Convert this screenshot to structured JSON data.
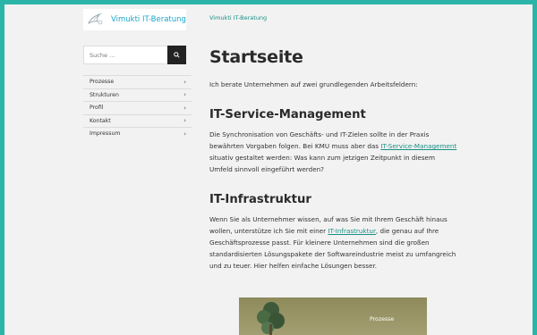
{
  "brand": {
    "logo_text": "Vimukti IT-Beratung",
    "accent_color": "#1aa6c9",
    "frame_color": "#2bb5a8"
  },
  "header": {
    "site_title": "Vimukti IT-Beratung"
  },
  "search": {
    "placeholder": "Suche …",
    "button_icon": "search-icon"
  },
  "sidebar": {
    "items": [
      {
        "label": "Prozesse",
        "icon": "chevron-right-icon"
      },
      {
        "label": "Strukturen",
        "icon": "chevron-right-icon"
      },
      {
        "label": "Profil",
        "icon": "chevron-right-icon"
      },
      {
        "label": "Kontakt",
        "icon": "chevron-right-icon"
      },
      {
        "label": "Impressum",
        "icon": "chevron-right-icon"
      }
    ]
  },
  "main": {
    "title": "Startseite",
    "intro": "Ich berate Unternehmen auf zwei grundlegenden Arbeitsfeldern:",
    "sections": [
      {
        "heading": "IT-Service-Management",
        "text_before": "Die Synchronisation von Geschäfts- und IT-Zielen sollte in der Praxis bewährten Vorgaben folgen. Bei KMU muss aber das ",
        "link": "IT-Service-Management",
        "text_after": " situativ gestaltet werden: Was kann zum jetzigen Zeitpunkt in diesem Umfeld sinnvoll eingeführt werden?"
      },
      {
        "heading": "IT-Infrastruktur",
        "text_before": "Wenn Sie als Unternehmer wissen, auf was Sie mit Ihrem Geschäft hinaus wollen, unterstütze ich Sie mit einer ",
        "link": "IT-Infrastruktur",
        "text_after": ", die genau auf Ihre Geschäftsprozesse passt. Für kleinere Unternehmen sind die großen standardisierten Lösungspakete der Softwareindustrie meist zu umfangreich und zu teuer. Hier helfen einfache Lösungen besser."
      }
    ],
    "hero_label": "Prozesse"
  }
}
